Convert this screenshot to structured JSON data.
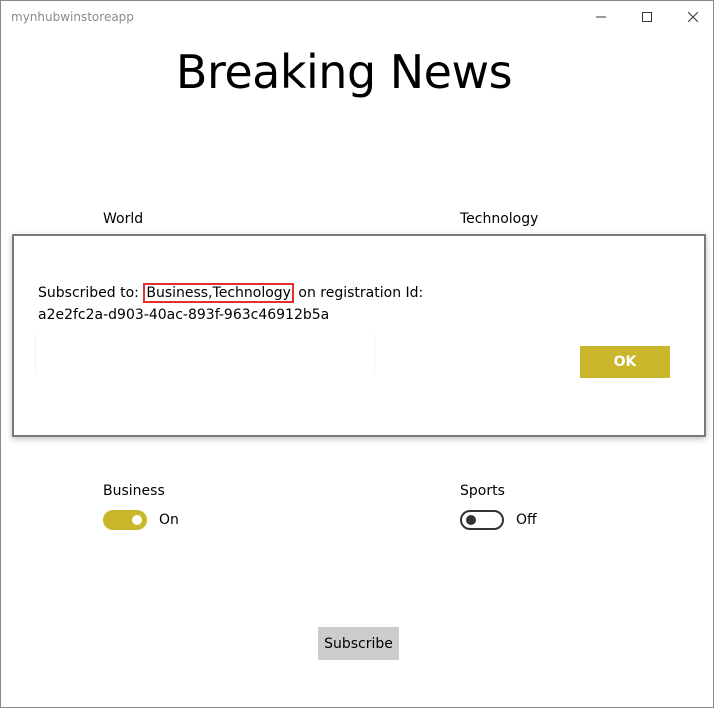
{
  "window": {
    "title": "mynhubwinstoreapp"
  },
  "headline": "Breaking News",
  "categories": {
    "world": {
      "label": "World"
    },
    "technology": {
      "label": "Technology"
    },
    "business": {
      "label": "Business",
      "state": "On"
    },
    "sports": {
      "label": "Sports",
      "state": "Off"
    }
  },
  "subscribe_label": "Subscribe",
  "dialog": {
    "prefix": "Subscribed to: ",
    "highlighted": "Business,Technology",
    "suffix": " on registration Id:",
    "registration_id": "a2e2fc2a-d903-40ac-893f-963c46912b5a",
    "ok_label": "OK"
  },
  "colors": {
    "accent": "#c9b62a",
    "highlight_border": "#e03030",
    "button_gray": "#cccccc"
  },
  "icons": {
    "minimize": "minimize-icon",
    "maximize": "maximize-icon",
    "close": "close-icon"
  }
}
